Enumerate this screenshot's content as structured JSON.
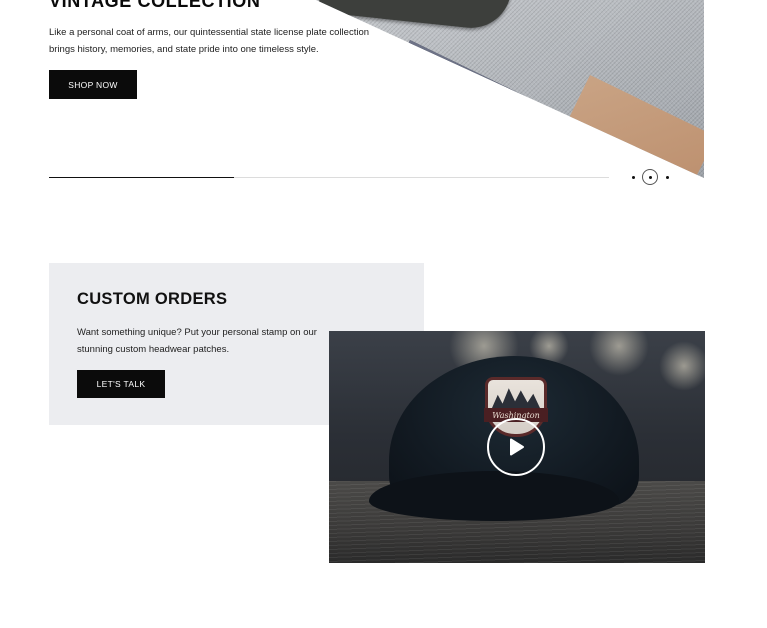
{
  "hero": {
    "title": "VINTAGE COLLECTION",
    "description": "Like a personal coat of arms, our quintessential state license plate collection brings history, memories, and state pride into one timeless style.",
    "button_label": "SHOP NOW",
    "slider_progress_percent": 33,
    "slide_count": 3,
    "active_slide": 2
  },
  "custom_orders": {
    "title": "CUSTOM ORDERS",
    "description": "Want something unique? Put your personal stamp on our stunning custom headwear patches.",
    "button_label": "LET'S TALK",
    "video": {
      "patch_text": "Washington",
      "play_icon": "play-icon"
    }
  },
  "colors": {
    "button_bg": "#0b0b0b",
    "panel_bg": "#ecedf0",
    "text": "#111111"
  }
}
